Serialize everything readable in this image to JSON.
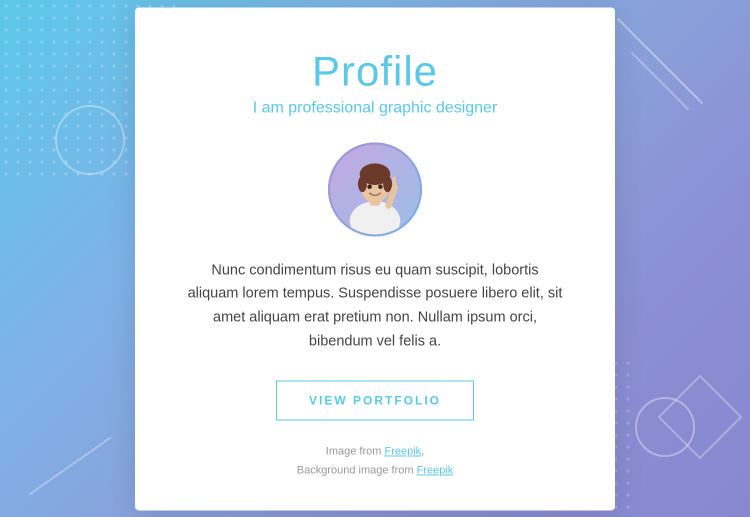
{
  "background": {
    "gradient": "linear-gradient(135deg, #5bc8e8, #8888d0)"
  },
  "card": {
    "title": "Profile",
    "subtitle": "I am professional graphic designer",
    "bio": "Nunc condimentum risus eu quam suscipit, lobortis aliquam lorem tempus. Suspendisse posuere libero elit, sit amet aliquam erat pretium non. Nullam ipsum orci, bibendum vel felis a.",
    "button_label": "VIEW PORTFOLIO",
    "credit_line1": "Image from ",
    "credit_link1": "Freepik",
    "credit_line2": "Background image from ",
    "credit_link2": "Freepik"
  }
}
